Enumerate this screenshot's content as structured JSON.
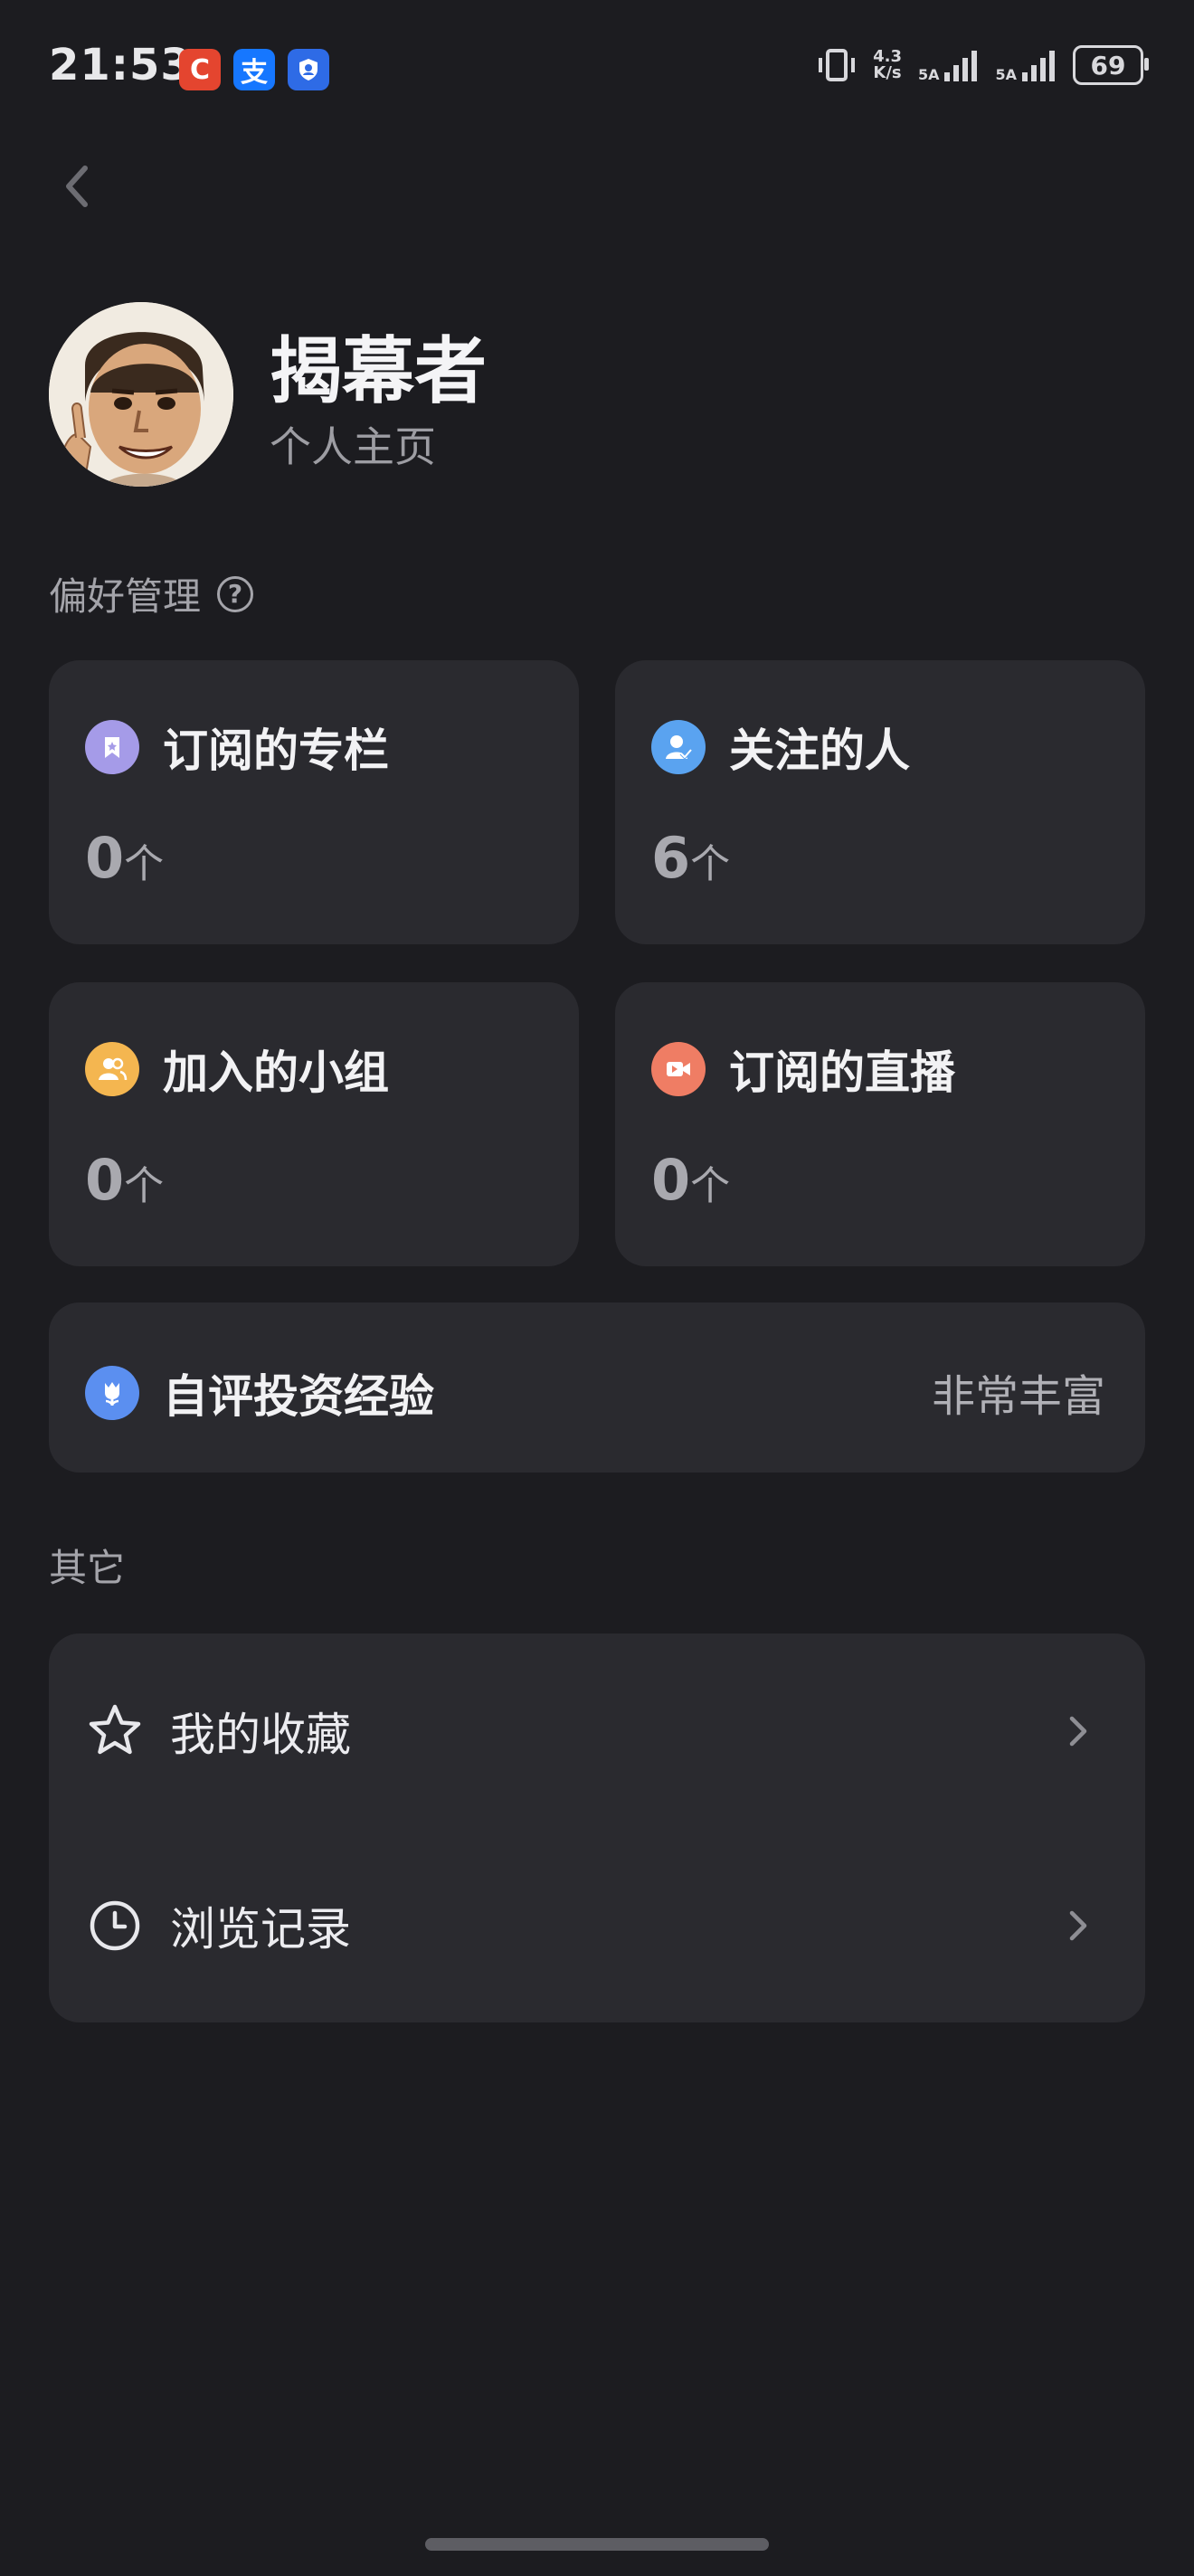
{
  "status_bar": {
    "time": "21:53",
    "app_icons": [
      {
        "name": "c-app-icon",
        "glyph": "C",
        "color": "#e4452f"
      },
      {
        "name": "alipay-icon",
        "glyph": "支",
        "color": "#1677ff"
      },
      {
        "name": "shield-app-icon",
        "glyph": "",
        "color": "#2e6be6"
      }
    ],
    "net_speed": "4.3",
    "net_unit": "K/s",
    "signal_1_label": "5A",
    "signal_2_label": "5A",
    "battery": "69"
  },
  "profile": {
    "name": "揭幕者",
    "subtitle": "个人主页"
  },
  "preferences": {
    "title": "偏好管理",
    "help_glyph": "?",
    "cards": [
      {
        "title": "订阅的专栏",
        "count": "0",
        "unit": "个",
        "icon": "bookmark-icon",
        "color": "#a59be8"
      },
      {
        "title": "关注的人",
        "count": "6",
        "unit": "个",
        "icon": "person-check-icon",
        "color": "#5aa3f0"
      },
      {
        "title": "加入的小组",
        "count": "0",
        "unit": "个",
        "icon": "group-icon",
        "color": "#f4b650"
      },
      {
        "title": "订阅的直播",
        "count": "0",
        "unit": "个",
        "icon": "video-icon",
        "color": "#ef7d64"
      }
    ],
    "experience": {
      "label": "自评投资经验",
      "value": "非常丰富",
      "icon": "tulip-icon",
      "color": "#5b8ff0"
    }
  },
  "others": {
    "title": "其它",
    "items": [
      {
        "label": "我的收藏",
        "icon": "star-icon"
      },
      {
        "label": "浏览记录",
        "icon": "clock-icon"
      }
    ]
  }
}
